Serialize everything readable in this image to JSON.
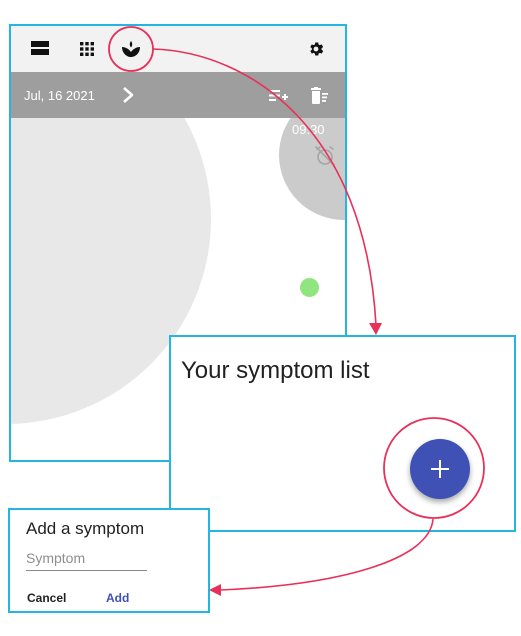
{
  "main_screen": {
    "toolbar": {
      "icons": [
        "view-list-icon",
        "apps-grid-icon",
        "symptom-icon",
        "gear-icon"
      ]
    },
    "date_bar": {
      "date": "Jul, 16 2021",
      "icons": [
        "chevron-right-icon",
        "playlist-add-icon",
        "delete-sweep-icon"
      ]
    },
    "time": "09:30",
    "alarm_icon": "alarm-off-icon"
  },
  "symptom_list_screen": {
    "title": "Your symptom list",
    "fab_icon": "plus-icon"
  },
  "add_symptom_dialog": {
    "title": "Add a symptom",
    "input_placeholder": "Symptom",
    "cancel_label": "Cancel",
    "add_label": "Add"
  },
  "colors": {
    "frame_border": "#22b6e0",
    "annotation": "#e8315a",
    "accent": "#3f51b5",
    "toolbar_bg": "#f2f2f2",
    "date_bar_bg": "#9e9e9e",
    "event_dot": "#90e57f"
  }
}
